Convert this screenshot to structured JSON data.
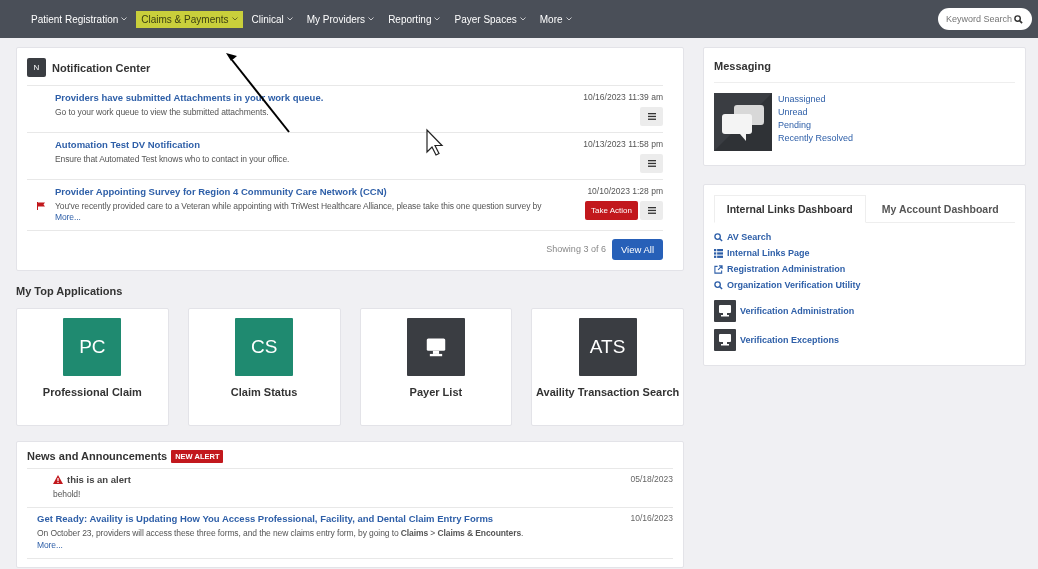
{
  "nav": {
    "items": [
      {
        "label": "Patient Registration",
        "selected": false
      },
      {
        "label": "Claims & Payments",
        "selected": true
      },
      {
        "label": "Clinical",
        "selected": false
      },
      {
        "label": "My Providers",
        "selected": false
      },
      {
        "label": "Reporting",
        "selected": false
      },
      {
        "label": "Payer Spaces",
        "selected": false
      },
      {
        "label": "More",
        "selected": false
      }
    ],
    "search": {
      "placeholder": "Keyword Search"
    }
  },
  "notification_center": {
    "badge": "N",
    "title": "Notification Center",
    "items": [
      {
        "title": "Providers have submitted Attachments in your work queue.",
        "body": "Go to your work queue to view the submitted attachments.",
        "time": "10/16/2023 11:39 am",
        "flagged": false
      },
      {
        "title": "Automation Test DV Notification",
        "body": "Ensure that Automated Test knows who to contact in your office.",
        "time": "10/13/2023 11:58 pm",
        "flagged": false
      },
      {
        "title": "Provider Appointing Survey for Region 4 Community Care Network (CCN)",
        "body": "You've recently provided care to a Veteran while appointing with TriWest Healthcare Alliance, please take this one question survey by",
        "more": "More...",
        "time": "10/10/2023 1:28 pm",
        "flagged": true,
        "action": "Take Action"
      }
    ],
    "showing": "Showing 3 of 6",
    "view_all": "View All"
  },
  "top_applications": {
    "title": "My Top Applications",
    "apps": [
      {
        "kind": "text",
        "tile": "PC",
        "color": "#1f8a70",
        "label": "Professional Claim"
      },
      {
        "kind": "text",
        "tile": "CS",
        "color": "#1f8a70",
        "label": "Claim Status"
      },
      {
        "kind": "monitor",
        "color": "#3a3d42",
        "label": "Payer List"
      },
      {
        "kind": "text",
        "tile": "ATS",
        "color": "#3a3d42",
        "label": "Availity Transaction Search"
      }
    ]
  },
  "news": {
    "title": "News and Announcements",
    "badge": "NEW ALERT",
    "items": [
      {
        "kind": "alert",
        "title": "this is an alert",
        "body": "behold!",
        "date": "05/18/2023"
      },
      {
        "kind": "link",
        "title": "Get Ready: Availity is Updating How You Access Professional, Facility, and Dental Claim Entry Forms",
        "body": "On October 23, providers will access these three forms, and the new claims entry form, by going to **Claims** > **Claims & Encounters**.",
        "more": "More...",
        "date": "10/16/2023"
      }
    ]
  },
  "messaging": {
    "title": "Messaging",
    "links": [
      "Unassigned",
      "Unread",
      "Pending",
      "Recently Resolved"
    ]
  },
  "dashboard": {
    "tabs": [
      {
        "label": "Internal Links Dashboard",
        "selected": true
      },
      {
        "label": "My Account Dashboard",
        "selected": false
      }
    ],
    "links": [
      {
        "kind": "search",
        "label": "AV Search"
      },
      {
        "kind": "list",
        "label": "Internal Links Page"
      },
      {
        "kind": "external",
        "label": "Registration Administration"
      },
      {
        "kind": "search",
        "label": "Organization Verification Utility"
      },
      {
        "kind": "monitor",
        "label": "Verification Administration"
      },
      {
        "kind": "monitor",
        "label": "Verification Exceptions"
      }
    ]
  }
}
